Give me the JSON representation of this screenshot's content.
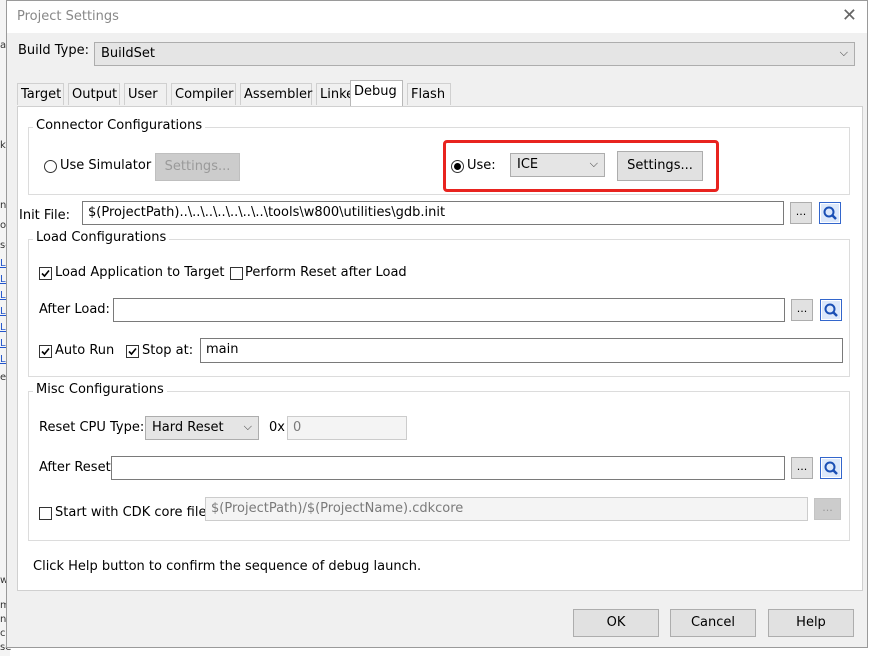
{
  "background": {
    "fragments": [
      "a",
      "k",
      "n",
      "o",
      "sc",
      "e",
      "w",
      "m",
      "n",
      "co",
      "se"
    ],
    "link_fragments": [
      "Lc",
      "Lc",
      "Lc",
      "Lc",
      "Lc",
      "Lc",
      "Lc"
    ]
  },
  "window": {
    "title": "Project Settings",
    "close_glyph": "✕"
  },
  "build_type": {
    "label": "Build Type:",
    "value": "BuildSet",
    "arrow": "⌵"
  },
  "tabs": [
    "Target",
    "Output",
    "User",
    "Compiler",
    "Assembler",
    "Linker",
    "Debug",
    "Flash"
  ],
  "active_tab": "Debug",
  "connector": {
    "title": "Connector Configurations",
    "use_simulator_label": "Use Simulator",
    "use_simulator_selected": false,
    "simulator_settings_label": "Settings...",
    "use_label": "Use:",
    "use_selected": true,
    "use_value": "ICE",
    "use_arrow": "⌵",
    "ice_settings_label": "Settings...",
    "highlight_color": "#e8231f"
  },
  "init_file": {
    "label": "Init File:",
    "value": "$(ProjectPath)..\\..\\..\\..\\..\\..\\..\\tools\\w800\\utilities\\gdb.init",
    "browse_label": "..."
  },
  "load": {
    "title": "Load Configurations",
    "load_app_label": "Load Application to Target",
    "load_app_checked": true,
    "perform_reset_label": "Perform Reset after Load",
    "perform_reset_checked": false,
    "after_load_label": "After Load:",
    "after_load_value": "",
    "browse_label": "...",
    "auto_run_label": "Auto Run",
    "auto_run_checked": true,
    "stop_at_label": "Stop at:",
    "stop_at_checked": true,
    "stop_at_value": "main"
  },
  "misc": {
    "title": "Misc Configurations",
    "reset_cpu_label": "Reset CPU Type:",
    "reset_cpu_value": "Hard Reset",
    "reset_arrow": "⌵",
    "hex_prefix": "0x",
    "hex_value": "0",
    "after_reset_label": "After Reset:",
    "after_reset_value": "",
    "browse_label": "...",
    "cdk_core_label": "Start with CDK core file:",
    "cdk_core_checked": false,
    "cdk_core_value": "$(ProjectPath)/$(ProjectName).cdkcore",
    "cdk_browse_label": "..."
  },
  "help_text": "Click Help button to confirm the sequence of debug launch.",
  "footer": {
    "ok": "OK",
    "cancel": "Cancel",
    "help": "Help"
  }
}
